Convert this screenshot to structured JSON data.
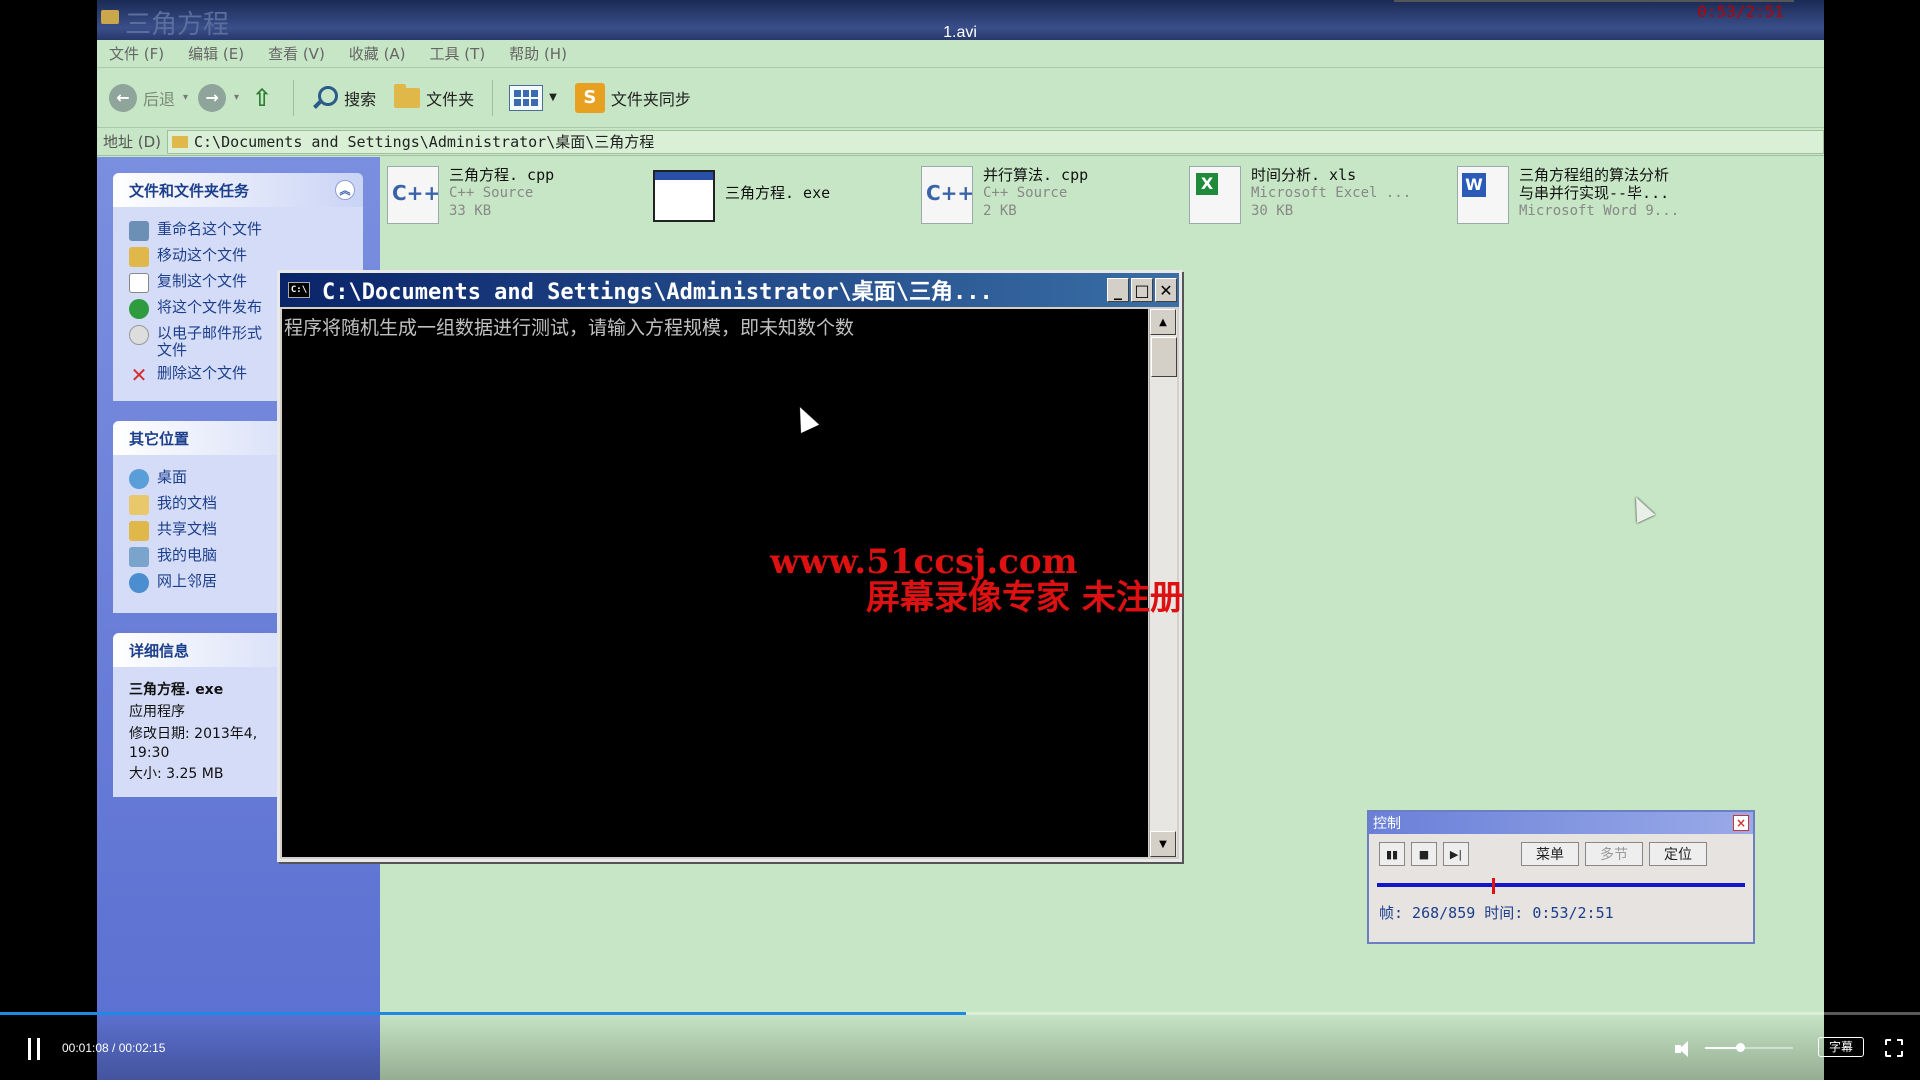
{
  "player": {
    "title": "1.avi",
    "time_label": "00:01:08 / 00:02:15",
    "progress_fraction": 0.503,
    "volume_fraction": 0.4,
    "subtitle_label": "字幕"
  },
  "explorer": {
    "window_title": "三角方程",
    "recording_timestamp": "0:53/2:51",
    "menu": [
      "文件 (F)",
      "编辑 (E)",
      "查看 (V)",
      "收藏 (A)",
      "工具 (T)",
      "帮助 (H)"
    ],
    "toolbar": {
      "back": "后退",
      "search": "搜索",
      "folders": "文件夹",
      "sync": "文件夹同步"
    },
    "address": {
      "label": "地址 (D)",
      "path": "C:\\Documents and Settings\\Administrator\\桌面\\三角方程"
    },
    "tasks": {
      "title": "文件和文件夹任务",
      "items": [
        "重命名这个文件",
        "移动这个文件",
        "复制这个文件",
        "将这个文件发布",
        "以电子邮件形式\n文件",
        "删除这个文件"
      ]
    },
    "places": {
      "title": "其它位置",
      "items": [
        "桌面",
        "我的文档",
        "共享文档",
        "我的电脑",
        "网上邻居"
      ]
    },
    "details": {
      "title": "详细信息",
      "name": "三角方程. exe",
      "type": "应用程序",
      "modified": "修改日期: 2013年4,",
      "modified_time": "19:30",
      "size": "大小: 3.25 MB"
    },
    "files": [
      {
        "name": "三角方程. cpp",
        "type": "C++ Source",
        "size": "33 KB"
      },
      {
        "name": "三角方程. exe",
        "type": "",
        "size": ""
      },
      {
        "name": "并行算法. cpp",
        "type": "C++ Source",
        "size": "2 KB"
      },
      {
        "name": "时间分析. xls",
        "type": "Microsoft Excel ...",
        "size": "30 KB"
      },
      {
        "name": "三角方程组的算法分析",
        "name2": "与串并行实现--毕...",
        "type": "Microsoft Word 9..."
      }
    ]
  },
  "console": {
    "title": "C:\\Documents and Settings\\Administrator\\桌面\\三角...",
    "output": "程序将随机生成一组数据进行测试，请输入方程规模，即未知数个数"
  },
  "watermark": {
    "line1": "www.51ccsj.com",
    "line2": "屏幕录像专家  未注册"
  },
  "recorder": {
    "title": "控制",
    "menu_label": "菜单",
    "multi_label": "多节",
    "locate_label": "定位",
    "status": "帧: 268/859 时间: 0:53/2:51"
  }
}
